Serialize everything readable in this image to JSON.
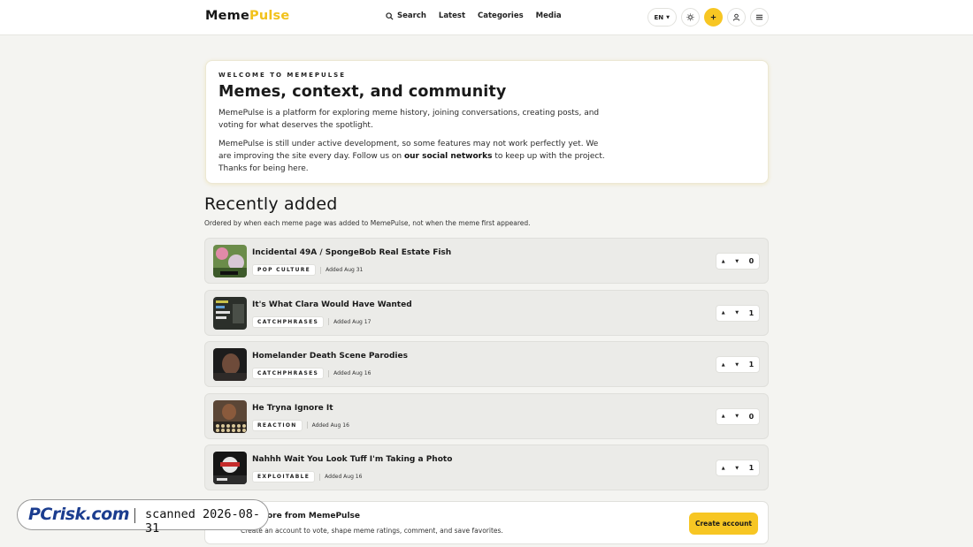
{
  "header": {
    "logo_part1": "Meme",
    "logo_part2": "Pulse",
    "nav": [
      {
        "label": "Search",
        "icon": "search-icon"
      },
      {
        "label": "Latest"
      },
      {
        "label": "Categories"
      },
      {
        "label": "Media"
      }
    ],
    "language": "EN",
    "icons": [
      "sun-icon",
      "plus-icon",
      "user-icon",
      "menu-icon"
    ],
    "colors": {
      "accent": "#f7c623",
      "brand_pulse": "#f2c21b"
    }
  },
  "welcome": {
    "eyebrow": "WELCOME TO MEMEPULSE",
    "title": "Memes, context, and community",
    "p1": "MemePulse is a platform for exploring meme history, joining conversations, creating posts, and voting for what deserves the spotlight.",
    "p2_before": "MemePulse is still under active development, so some features may not work perfectly yet. We are improving the site every day. Follow us on ",
    "p2_link": "our social networks",
    "p2_after": " to keep up with the project. Thanks for being here."
  },
  "recent": {
    "title": "Recently added",
    "subtitle": "Ordered by when each meme page was added to MemePulse, not when the meme first appeared.",
    "items": [
      {
        "title": "Incidental 49A / SpongeBob Real Estate Fish",
        "tag": "POP CULTURE",
        "added": "Added Aug 31",
        "votes": "0"
      },
      {
        "title": "It's What Clara Would Have Wanted",
        "tag": "CATCHPHRASES",
        "added": "Added Aug 17",
        "votes": "1"
      },
      {
        "title": "Homelander Death Scene Parodies",
        "tag": "CATCHPHRASES",
        "added": "Added Aug 16",
        "votes": "1"
      },
      {
        "title": "He Tryna Ignore It",
        "tag": "REACTION",
        "added": "Added Aug 16",
        "votes": "0"
      },
      {
        "title": "Nahhh Wait You Look Tuff I'm Taking a Photo",
        "tag": "EXPLOITABLE",
        "added": "Added Aug 16",
        "votes": "1"
      }
    ]
  },
  "cta": {
    "title": "ore from MemePulse",
    "subtitle": "Create an account to vote, shape meme ratings, comment, and save favorites.",
    "button": "Create account"
  },
  "watermark": {
    "brand": "PCrisk.com",
    "scanned": "scanned 2026-08-31"
  }
}
